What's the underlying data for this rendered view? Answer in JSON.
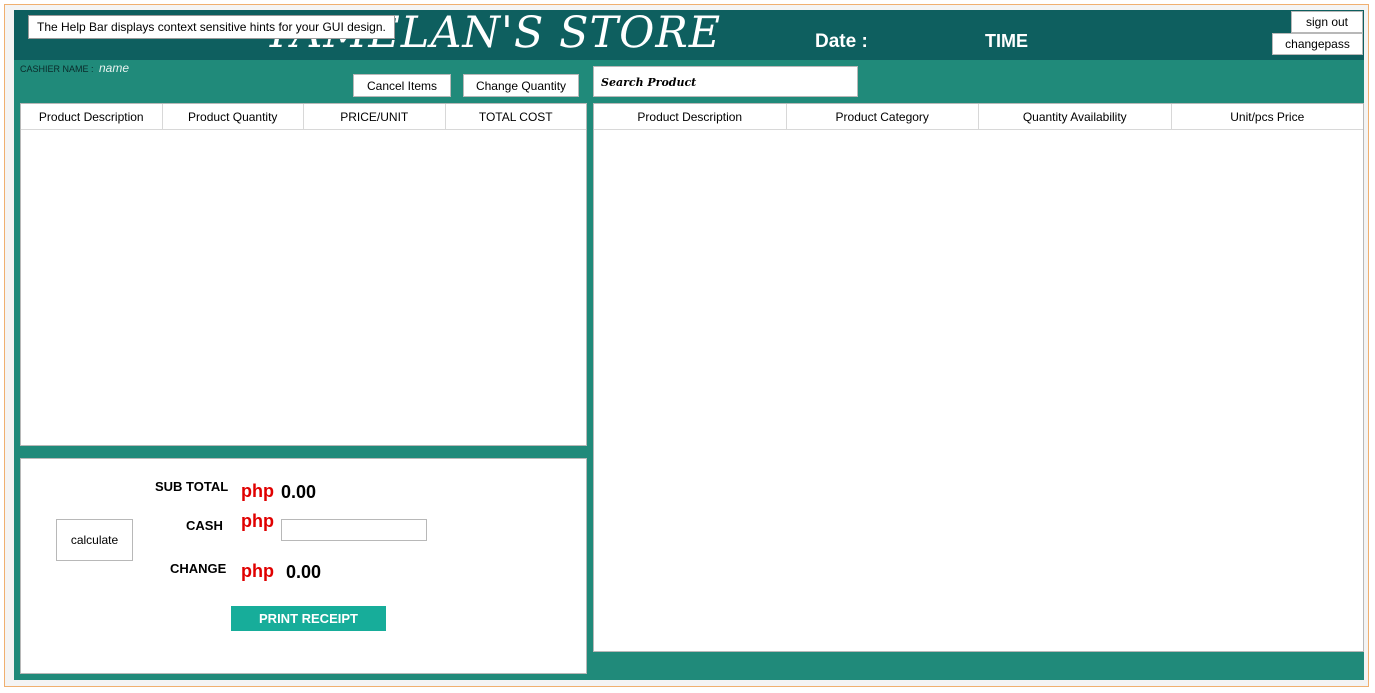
{
  "header": {
    "title": "TAMELAN'S STORE",
    "help_tip": "The Help Bar displays context sensitive hints for your GUI design.",
    "date_label": "Date :",
    "time_label": "TIME",
    "signout_label": "sign out",
    "changepass_label": "changepass"
  },
  "cashier": {
    "label": "CASHIER NAME :",
    "name": "name"
  },
  "toolbar": {
    "cancel_label": "Cancel Items",
    "change_quantity_label": "Change Quantity",
    "search_placeholder": "Search Product"
  },
  "cart_table": {
    "columns": [
      "Product Description",
      "Product Quantity",
      "PRICE/UNIT",
      "TOTAL COST"
    ]
  },
  "product_table": {
    "columns": [
      "Product Description",
      "Product Category",
      "Quantity Availability",
      "Unit/pcs  Price"
    ]
  },
  "calc": {
    "calculate_label": "calculate",
    "subtotal_label": "SUB TOTAL",
    "cash_label": "CASH",
    "change_label": "CHANGE",
    "currency": "php",
    "subtotal_value": "0.00",
    "change_value": "0.00",
    "print_label": "PRINT RECEIPT"
  },
  "colors": {
    "header": "#0e5f5f",
    "body": "#208a7a",
    "print_button": "#17ad9a",
    "currency": "#e00000"
  }
}
